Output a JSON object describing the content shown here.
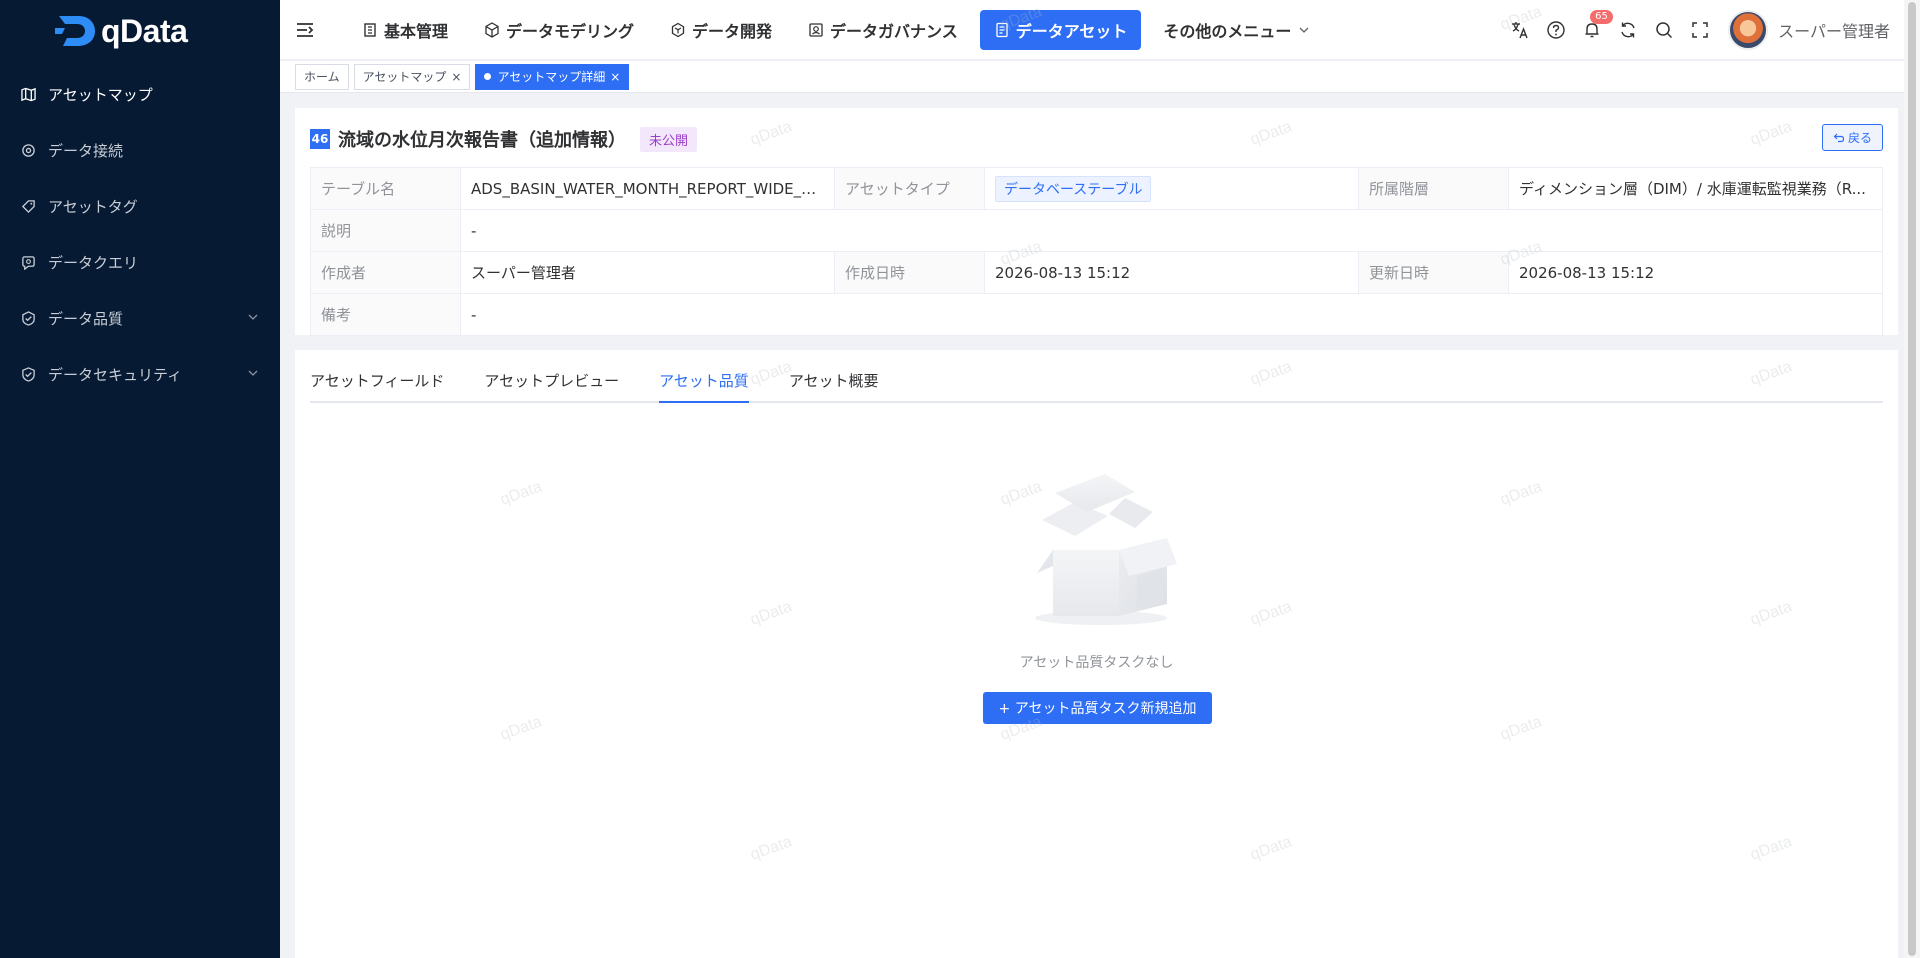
{
  "app": {
    "name": "qData",
    "brand_color": "#2d6ef5",
    "sidebar_bg": "#061a33"
  },
  "sidebar": {
    "items": [
      {
        "label": "アセットマップ",
        "icon": "map-icon"
      },
      {
        "label": "データ接続",
        "icon": "connection-icon"
      },
      {
        "label": "アセットタグ",
        "icon": "tag-icon"
      },
      {
        "label": "データクエリ",
        "icon": "query-icon"
      },
      {
        "label": "データ品質",
        "icon": "quality-icon"
      },
      {
        "label": "データセキュリティ",
        "icon": "shield-icon"
      }
    ]
  },
  "header": {
    "nav": [
      {
        "label": "基本管理",
        "icon": "building-icon"
      },
      {
        "label": "データモデリング",
        "icon": "cube-icon"
      },
      {
        "label": "データ開発",
        "icon": "hexagon-icon"
      },
      {
        "label": "データガバナンス",
        "icon": "governance-icon"
      },
      {
        "label": "データアセット",
        "icon": "asset-icon"
      },
      {
        "label": "その他のメニュー",
        "icon": "chevron-down-icon"
      }
    ],
    "notification_count": "65",
    "username": "スーパー管理者"
  },
  "tagsbar": {
    "tags": [
      {
        "label": "ホーム"
      },
      {
        "label": "アセットマップ"
      },
      {
        "label": "アセットマップ詳細"
      }
    ]
  },
  "detail": {
    "number": "46",
    "title": "流域の水位月次報告書（追加情報）",
    "status": "未公開",
    "back_label": "戻る",
    "rows": {
      "table_name_label": "テーブル名",
      "table_name": "ADS_BASIN_WATER_MONTH_REPORT_WIDE_A...",
      "asset_type_label": "アセットタイプ",
      "asset_type": "データベーステーブル",
      "layer_label": "所属階層",
      "layer": "ディメンション層（DIM）/ 水庫運転監視業務（R...",
      "desc_label": "説明",
      "desc": "-",
      "creator_label": "作成者",
      "creator": "スーパー管理者",
      "created_label": "作成日時",
      "created": "2026-08-13 15:12",
      "updated_label": "更新日時",
      "updated": "2026-08-13 15:12",
      "remark_label": "備考",
      "remark": "-"
    }
  },
  "tabs": [
    {
      "label": "アセットフィールド"
    },
    {
      "label": "アセットプレビュー"
    },
    {
      "label": "アセット品質"
    },
    {
      "label": "アセット概要"
    }
  ],
  "empty": {
    "text": "アセット品質タスクなし",
    "button": "+ アセット品質タスク新規追加"
  },
  "watermark": "qData"
}
